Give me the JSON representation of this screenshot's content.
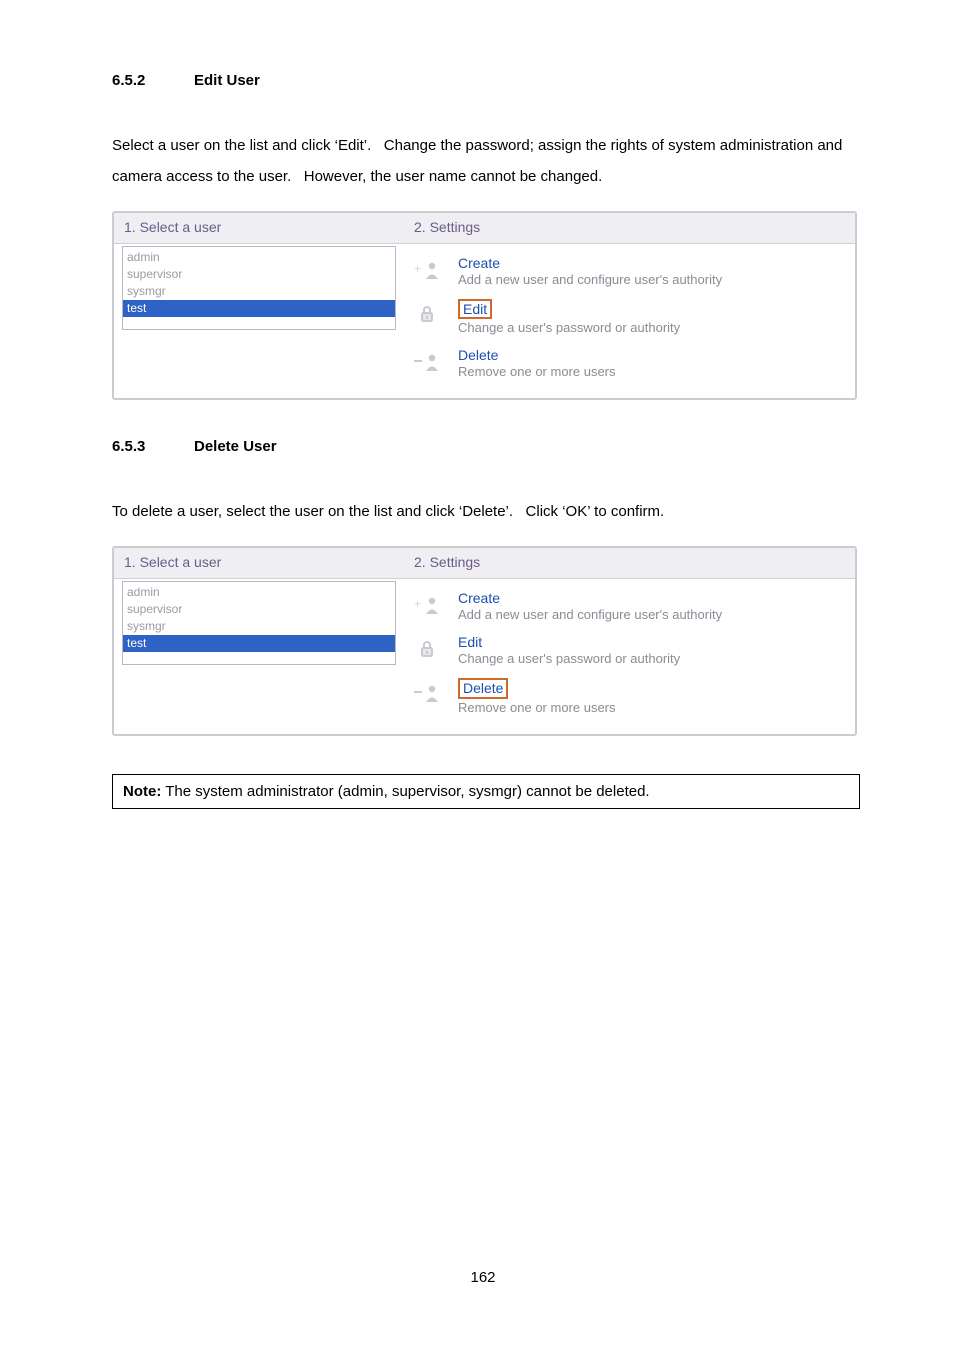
{
  "section_edit": {
    "number": "6.5.2",
    "title": "Edit User",
    "paragraph": "Select a user on the list and click ‘Edit’.   Change the password; assign the rights of system administration and camera access to the user.   However, the user name cannot be changed."
  },
  "section_delete": {
    "number": "6.5.3",
    "title": "Delete User",
    "paragraph": "To delete a user, select the user on the list and click ‘Delete’.   Click ‘OK’ to confirm."
  },
  "panel_labels": {
    "step1": "1. Select a user",
    "step2": "2. Settings"
  },
  "users": {
    "items": [
      "admin",
      "supervisor",
      "sysmgr",
      "test"
    ],
    "selected_index": 3
  },
  "actions": {
    "create": {
      "title": "Create",
      "desc": "Add a new user and configure user's authority"
    },
    "edit": {
      "title": "Edit",
      "desc": "Change a user's password or authority"
    },
    "delete": {
      "title": "Delete",
      "desc": "Remove one or more users"
    }
  },
  "note": {
    "label": "Note:",
    "text": " The system administrator (admin, supervisor, sysmgr) cannot be deleted."
  },
  "page_number": "162"
}
